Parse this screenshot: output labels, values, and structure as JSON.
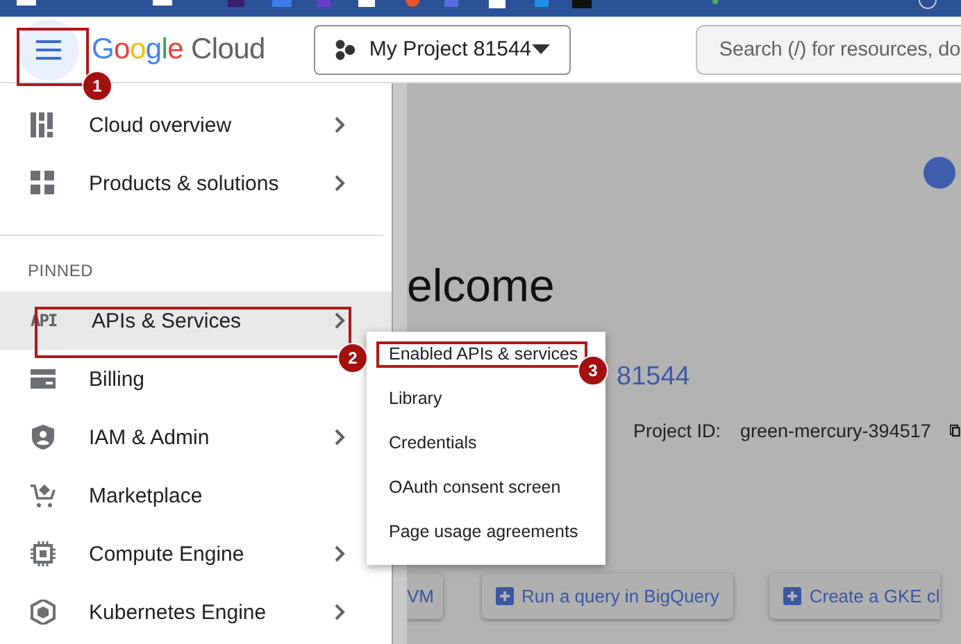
{
  "header": {
    "menu_button": {
      "annotation": "1"
    },
    "logo": {
      "brand": "Google",
      "product": "Cloud"
    },
    "project_button": {
      "label": "My Project 81544"
    },
    "search": {
      "placeholder": "Search (/) for resources, do"
    }
  },
  "sidebar": {
    "items": [
      {
        "label": "Cloud overview",
        "has_submenu": true,
        "selected": false
      },
      {
        "label": "Products & solutions",
        "has_submenu": true,
        "selected": false
      }
    ],
    "section_label": "PINNED",
    "pinned_items": [
      {
        "label": "APIs & Services",
        "has_submenu": true,
        "selected": true,
        "icon_text": "API",
        "annotation": "2"
      },
      {
        "label": "Billing",
        "has_submenu": false,
        "selected": false
      },
      {
        "label": "IAM & Admin",
        "has_submenu": true,
        "selected": false
      },
      {
        "label": "Marketplace",
        "has_submenu": false,
        "selected": false
      },
      {
        "label": "Compute Engine",
        "has_submenu": true,
        "selected": false
      },
      {
        "label": "Kubernetes Engine",
        "has_submenu": true,
        "selected": false
      }
    ]
  },
  "submenu": {
    "items": [
      {
        "label": "Enabled APIs & services",
        "annotation": "3"
      },
      {
        "label": "Library"
      },
      {
        "label": "Credentials"
      },
      {
        "label": "OAuth consent screen"
      },
      {
        "label": "Page usage agreements"
      }
    ]
  },
  "content": {
    "title": "elcome",
    "project_number": "81544",
    "project_id_label": "Project ID:",
    "project_id": "green-mercury-394517",
    "actions": [
      {
        "label": "VM",
        "has_icon": false
      },
      {
        "label": "Run a query in BigQuery",
        "has_icon": true
      },
      {
        "label": "Create a GKE cl",
        "has_icon": true
      }
    ]
  }
}
